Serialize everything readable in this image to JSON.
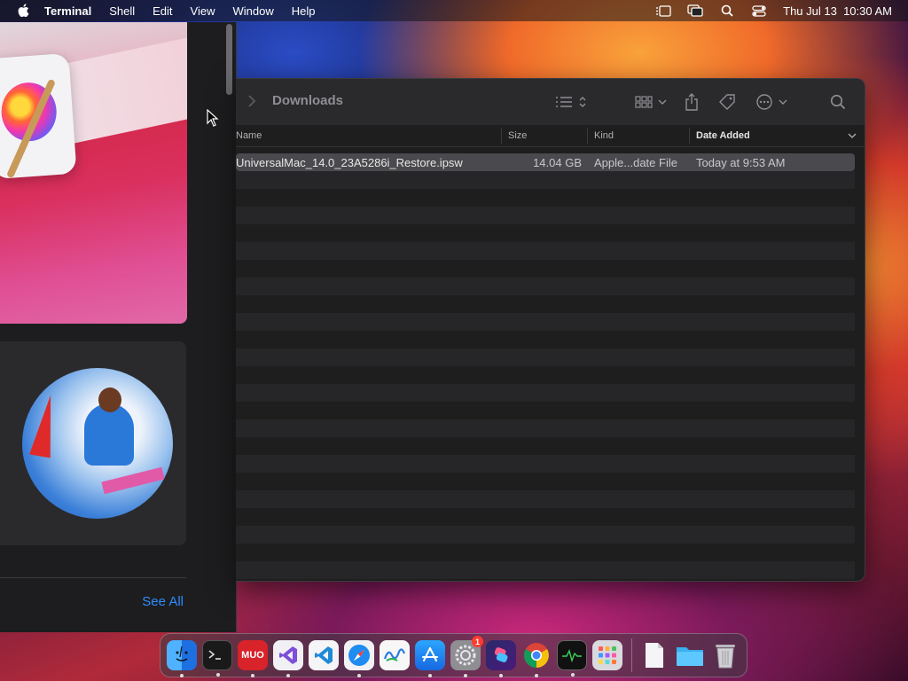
{
  "menubar": {
    "app_name": "Terminal",
    "menus": [
      "Shell",
      "Edit",
      "View",
      "Window",
      "Help"
    ],
    "clock": "Thu Jul 13  10:30 AM"
  },
  "left_panel": {
    "see_all": "See All"
  },
  "finder": {
    "title": "Downloads",
    "columns": {
      "name": "Name",
      "size": "Size",
      "kind": "Kind",
      "date_added": "Date Added"
    },
    "files": [
      {
        "name": "UniversalMac_14.0_23A5286i_Restore.ipsw",
        "size": "14.04 GB",
        "kind": "Apple...date File",
        "date_added": "Today at 9:53 AM"
      }
    ]
  },
  "dock": {
    "apps": [
      "finder-icon",
      "terminal-icon",
      "muo-icon",
      "visual-studio-icon",
      "vscode-icon",
      "safari-icon",
      "freeform-icon",
      "app-store-icon",
      "system-settings-icon",
      "shortcuts-icon",
      "chrome-icon",
      "activity-monitor-icon",
      "launchpad-icon",
      "document-icon",
      "folder-icon",
      "trash-icon"
    ],
    "muo_label": "MUO",
    "settings_badge": "1"
  },
  "colors": {
    "accent": "#2f8cff",
    "window_bg": "#1e1e1e",
    "badge": "#ff3b30"
  }
}
